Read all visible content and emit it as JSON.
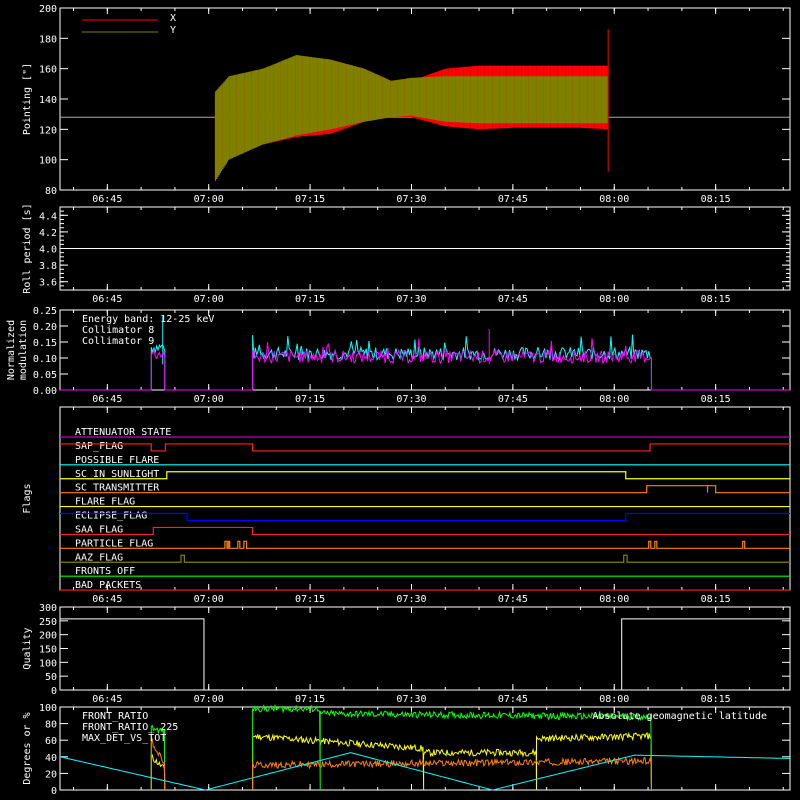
{
  "time_axis": {
    "ticks": [
      "06:45",
      "07:00",
      "07:15",
      "07:30",
      "07:45",
      "08:00",
      "08:15"
    ],
    "tick_minutes": [
      405,
      420,
      435,
      450,
      465,
      480,
      495
    ],
    "range_minutes": [
      398,
      506
    ]
  },
  "colors": {
    "background": "#000000",
    "axes": "#ffffff",
    "x": "#ff0000",
    "y": "#808000",
    "cyan": "#00ffff",
    "magenta": "#ff00ff",
    "white": "#ffffff",
    "yellow": "#ffff00",
    "green": "#00ff00",
    "orange": "#ff8000",
    "red": "#ff2020",
    "blue": "#0000ff",
    "olive": "#808000",
    "purple": "#c000c0"
  },
  "chart_data": [
    {
      "type": "line",
      "ylabel": "Pointing [\"]",
      "ylim": [
        80,
        200
      ],
      "yticks": [
        80,
        100,
        120,
        140,
        160,
        180,
        200
      ],
      "legend": [
        "X",
        "Y"
      ],
      "series": [
        {
          "name": "X",
          "color": "#ff0000",
          "start": 421.0,
          "end": 479.0,
          "envelope_upper": [
            [
              421,
              140
            ],
            [
              423,
              150
            ],
            [
              428,
              158
            ],
            [
              433,
              168
            ],
            [
              438,
              166
            ],
            [
              443,
              160
            ],
            [
              447,
              152
            ],
            [
              450,
              152
            ],
            [
              455,
              160
            ],
            [
              460,
              162
            ],
            [
              465,
              162
            ],
            [
              470,
              162
            ],
            [
              475,
              162
            ],
            [
              479,
              162
            ]
          ],
          "envelope_lower": [
            [
              421,
              88
            ],
            [
              423,
              103
            ],
            [
              428,
              110
            ],
            [
              433,
              115
            ],
            [
              438,
              117
            ],
            [
              443,
              125
            ],
            [
              447,
              128
            ],
            [
              450,
              128
            ],
            [
              455,
              122
            ],
            [
              460,
              120
            ],
            [
              465,
              121
            ],
            [
              470,
              121
            ],
            [
              475,
              121
            ],
            [
              479,
              120
            ]
          ]
        },
        {
          "name": "Y",
          "color": "#808000",
          "start": 421.0,
          "end": 479.0,
          "envelope_upper": [
            [
              421,
              145
            ],
            [
              423,
              155
            ],
            [
              428,
              160
            ],
            [
              433,
              169
            ],
            [
              438,
              166
            ],
            [
              443,
              160
            ],
            [
              447,
              152
            ],
            [
              450,
              154
            ],
            [
              455,
              155
            ],
            [
              460,
              155
            ],
            [
              465,
              155
            ],
            [
              470,
              155
            ],
            [
              475,
              155
            ],
            [
              479,
              155
            ]
          ],
          "envelope_lower": [
            [
              421,
              86
            ],
            [
              423,
              100
            ],
            [
              428,
              110
            ],
            [
              433,
              116
            ],
            [
              438,
              120
            ],
            [
              443,
              125
            ],
            [
              447,
              128
            ],
            [
              450,
              129
            ],
            [
              455,
              125
            ],
            [
              460,
              124
            ],
            [
              465,
              124
            ],
            [
              470,
              124
            ],
            [
              475,
              124
            ],
            [
              479,
              124
            ]
          ]
        }
      ],
      "baseline": 128
    },
    {
      "type": "line",
      "ylabel": "Roll period [s]",
      "ylim": [
        3.5,
        4.5
      ],
      "yticks": [
        3.6,
        3.8,
        4.0,
        4.2,
        4.4
      ],
      "series": [
        {
          "name": "",
          "color": "#ffffff",
          "values": [
            [
              398,
              4.0
            ],
            [
              506,
              4.0
            ]
          ]
        }
      ]
    },
    {
      "type": "line",
      "ylabel": "Normalized modulation",
      "ylim": [
        0,
        0.25
      ],
      "yticks": [
        0.0,
        0.05,
        0.1,
        0.15,
        0.2,
        0.25
      ],
      "legend": [
        "Energy band: 12-25 keV",
        "Collimator 8",
        "Collimator 9"
      ],
      "series": [
        {
          "name": "Collimator 8",
          "color": "#00ffff",
          "segments": [
            [
              411.5,
              413.5,
              0.13
            ],
            [
              426.5,
              485.5,
              0.11
            ]
          ],
          "spike": [
            413.2,
            0.23
          ]
        },
        {
          "name": "Collimator 9",
          "color": "#ff00ff",
          "segments": [
            [
              411.5,
              413.5,
              0.11
            ],
            [
              426.5,
              485.5,
              0.1
            ]
          ],
          "spike": [
            461.5,
            0.19
          ]
        }
      ]
    },
    {
      "type": "line",
      "ylabel": "Flags",
      "flags": [
        {
          "name": "ATTENUATOR_STATE",
          "color": "#c000c0",
          "high": []
        },
        {
          "name": "SAP_FLAG",
          "color": "#ff2020",
          "high": [
            [
              398,
              411.5
            ],
            [
              413.6,
              426.5
            ],
            [
              485.3,
              506
            ]
          ]
        },
        {
          "name": "POSSIBLE_FLARE",
          "color": "#00ffff",
          "high": []
        },
        {
          "name": "SC_IN_SUNLIGHT",
          "color": "#ffff00",
          "high": [
            [
              413.8,
              481.7
            ]
          ]
        },
        {
          "name": "SC_TRANSMITTER",
          "color": "#ff8000",
          "high": [
            [
              484.8,
              493.8
            ],
            [
              493.8,
              495.0
            ]
          ]
        },
        {
          "name": "FLARE_FLAG",
          "color": "#ffff00",
          "high": []
        },
        {
          "name": "ECLIPSE_FLAG",
          "color": "#0000ff",
          "high": [
            [
              398,
              416.8
            ],
            [
              481.7,
              506
            ]
          ]
        },
        {
          "name": "SAA_FLAG",
          "color": "#ff2020",
          "high": [
            [
              411.8,
              426.5
            ]
          ]
        },
        {
          "name": "PARTICLE_FLAG",
          "color": "#ff8000",
          "high": [
            [
              422.4,
              422.7
            ],
            [
              422.9,
              423.1
            ],
            [
              424.3,
              424.6
            ],
            [
              425.2,
              425.6
            ],
            [
              485.1,
              485.4
            ],
            [
              486.0,
              486.3
            ],
            [
              499.0,
              499.3
            ]
          ]
        },
        {
          "name": "AAZ_FLAG",
          "color": "#808000",
          "high": [
            [
              415.9,
              416.4
            ],
            [
              481.4,
              481.9
            ]
          ]
        },
        {
          "name": "FRONTS_OFF",
          "color": "#00ff00",
          "high": []
        },
        {
          "name": "BAD_PACKETS",
          "color": "#ff2020",
          "high": []
        }
      ]
    },
    {
      "type": "line",
      "ylabel": "Quality",
      "ylim": [
        0,
        300
      ],
      "yticks": [
        0,
        50,
        100,
        150,
        200,
        250,
        300
      ],
      "series": [
        {
          "name": "",
          "color": "#ffffff",
          "steps": [
            [
              398,
              257
            ],
            [
              419.3,
              0
            ],
            [
              481.1,
              257
            ],
            [
              506,
              257
            ]
          ]
        }
      ]
    },
    {
      "type": "line",
      "ylabel": "Degrees or %",
      "ylim": [
        0,
        100
      ],
      "yticks": [
        0,
        20,
        40,
        60,
        80,
        100
      ],
      "legend": [
        "FRONT_RATIO",
        "FRONT_RATIO_ 225",
        "MAX_DET_VS_TOT"
      ],
      "right_label": "Absolute geomagnetic latitude",
      "series": [
        {
          "name": "FRONT_RATIO",
          "color": "#ffff00",
          "segments": [
            [
              411.5,
              413.5,
              40,
              25
            ],
            [
              426.5,
              451.8,
              65,
              50
            ],
            [
              451.8,
              468.5,
              45,
              45
            ],
            [
              468.5,
              485.5,
              62,
              65
            ]
          ]
        },
        {
          "name": "FRONT_RATIO_ 225",
          "color": "#00ff00",
          "segments": [
            [
              411.5,
              413.5,
              75,
              70
            ],
            [
              426.5,
              436.5,
              98,
              98
            ],
            [
              436.5,
              485.5,
              92,
              88
            ]
          ]
        },
        {
          "name": "MAX_DET_VS_TOT",
          "color": "#ff8000",
          "segments": [
            [
              411.5,
              413.5,
              60,
              30
            ],
            [
              426.5,
              485.5,
              30,
              35
            ]
          ]
        },
        {
          "name": "Absolute geomagnetic latitude",
          "color": "#00ffff",
          "lat": [
            [
              398,
              40
            ],
            [
              419.5,
              0
            ],
            [
              441,
              45
            ],
            [
              462,
              0
            ],
            [
              483,
              42
            ],
            [
              506,
              38
            ]
          ]
        }
      ]
    }
  ]
}
